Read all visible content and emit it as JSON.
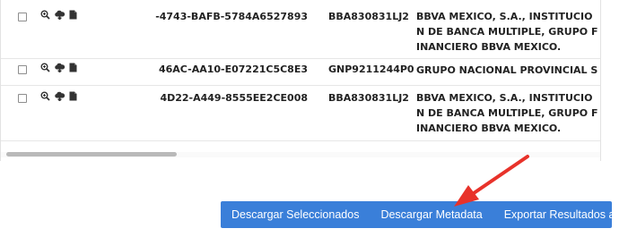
{
  "rows": [
    {
      "uuid": "-4743-BAFB-5784A6527893",
      "rfc": "BBA830831LJ2",
      "name": "BBVA MEXICO, S.A., INSTITUCION DE BANCA MULTIPLE, GRUPO FINANCIERO BBVA MEXICO."
    },
    {
      "uuid": "46AC-AA10-E07221C5C8E3",
      "rfc": "GNP9211244P0",
      "name": "GRUPO NACIONAL PROVINCIAL S A B"
    },
    {
      "uuid": "4D22-A449-8555EE2CE008",
      "rfc": "BBA830831LJ2",
      "name": "BBVA MEXICO, S.A., INSTITUCION DE BANCA MULTIPLE, GRUPO FINANCIERO BBVA MEXICO."
    }
  ],
  "row_icons": [
    "zoom-in-icon",
    "cloud-download-icon",
    "document-icon"
  ],
  "buttons": {
    "download_selected": "Descargar Seleccionados",
    "download_metadata": "Descargar Metadata",
    "export_pdf": "Exportar Resultados a PDF"
  },
  "colors": {
    "button_bar": "#3a7fd9",
    "annotation_arrow": "#e8322a"
  }
}
